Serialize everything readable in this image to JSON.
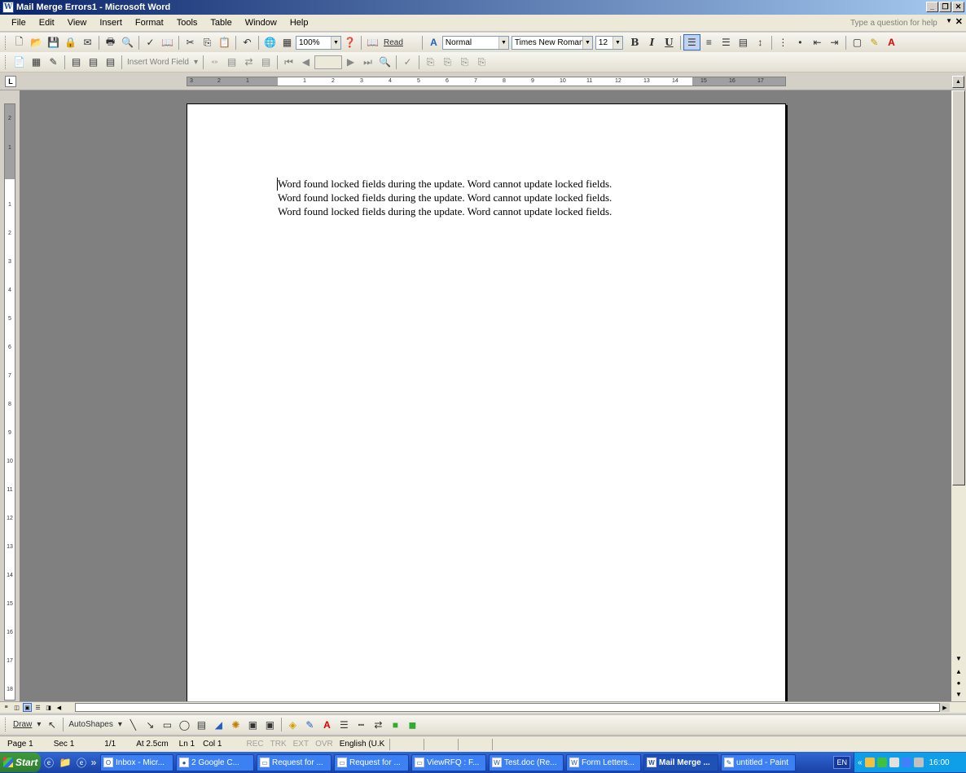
{
  "window": {
    "title": "Mail Merge Errors1 - Microsoft Word",
    "icon": "word-icon"
  },
  "menu": {
    "items": [
      "File",
      "Edit",
      "View",
      "Insert",
      "Format",
      "Tools",
      "Table",
      "Window",
      "Help"
    ],
    "help_placeholder": "Type a question for help"
  },
  "standard_toolbar": {
    "zoom": "100%",
    "read_label": "Read",
    "style": "Normal",
    "font": "Times New Roman",
    "font_size": "12",
    "bold": "B",
    "italic": "I",
    "underline": "U"
  },
  "mail_merge_toolbar": {
    "insert_word_field": "Insert Word Field"
  },
  "ruler": {
    "ticks": [
      "3",
      "2",
      "1",
      "1",
      "2",
      "3",
      "4",
      "5",
      "6",
      "7",
      "8",
      "9",
      "10",
      "11",
      "12",
      "13",
      "14",
      "15",
      "16",
      "17"
    ],
    "vticks": [
      "2",
      "1",
      "1",
      "2",
      "3",
      "4",
      "5",
      "6",
      "7",
      "8",
      "9",
      "10",
      "11",
      "12",
      "13",
      "14",
      "15",
      "16",
      "17",
      "18"
    ]
  },
  "document": {
    "lines": [
      "Word found locked fields during the update.  Word cannot update locked fields.",
      "Word found locked fields during the update.  Word cannot update locked fields.",
      "Word found locked fields during the update.  Word cannot update locked fields."
    ]
  },
  "drawing_toolbar": {
    "draw": "Draw",
    "autoshapes": "AutoShapes"
  },
  "status": {
    "page": "Page 1",
    "sec": "Sec 1",
    "pages": "1/1",
    "at": "At 2.5cm",
    "ln": "Ln 1",
    "col": "Col 1",
    "rec": "REC",
    "trk": "TRK",
    "ext": "EXT",
    "ovr": "OVR",
    "language": "English (U.K"
  },
  "taskbar": {
    "start": "Start",
    "tasks": [
      "Inbox - Micr...",
      "2 Google C...",
      "Request for ...",
      "Request for ...",
      "ViewRFQ : F...",
      "Test.doc (Re...",
      "Form Letters...",
      "Mail Merge ...",
      "untitled - Paint"
    ],
    "lang": "EN",
    "time": "16:00"
  }
}
